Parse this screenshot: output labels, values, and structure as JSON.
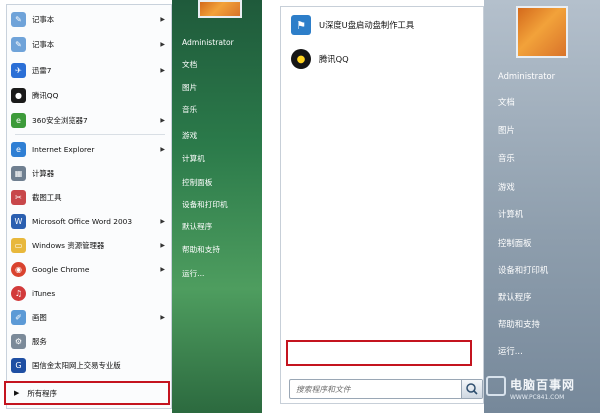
{
  "left": {
    "programs": [
      {
        "label": "记事本",
        "icon": "notepad-icon",
        "color": "#6fa3d9",
        "has_arrow": true
      },
      {
        "label": "记事本",
        "icon": "notepad-icon",
        "color": "#6fa3d9",
        "has_arrow": true
      },
      {
        "label": "迅雷7",
        "icon": "xunlei-icon",
        "color": "#2b6fd6",
        "has_arrow": true
      },
      {
        "label": "腾讯QQ",
        "icon": "qq-penguin-icon",
        "color": "#1a1a1a",
        "has_arrow": false
      },
      {
        "label": "360安全浏览器7",
        "icon": "360-browser-icon",
        "color": "#3d9b3a",
        "has_arrow": true
      },
      {
        "label": "Internet Explorer",
        "icon": "ie-icon",
        "color": "#2f7fd4",
        "has_arrow": true
      },
      {
        "label": "计算器",
        "icon": "calculator-icon",
        "color": "#6f7f90",
        "has_arrow": false
      },
      {
        "label": "截图工具",
        "icon": "snipping-tool-icon",
        "color": "#c8474a",
        "has_arrow": false
      },
      {
        "label": "Microsoft Office Word 2003",
        "icon": "word-icon",
        "color": "#2b5fb0",
        "has_arrow": true
      },
      {
        "label": "Windows 资源管理器",
        "icon": "explorer-folder-icon",
        "color": "#e8b83c",
        "has_arrow": true
      },
      {
        "label": "Google Chrome",
        "icon": "chrome-icon",
        "color": "#d9432f",
        "has_arrow": true
      },
      {
        "label": "iTunes",
        "icon": "itunes-icon",
        "color": "#d23b3b",
        "has_arrow": false
      },
      {
        "label": "画图",
        "icon": "paint-icon",
        "color": "#5c9ad6",
        "has_arrow": true
      },
      {
        "label": "服务",
        "icon": "services-gear-icon",
        "color": "#7b8a99",
        "has_arrow": false
      },
      {
        "label": "国信金太阳网上交易专业版",
        "icon": "guosen-icon",
        "color": "#1f4fa3",
        "has_arrow": false
      }
    ],
    "all_programs": "所有程序",
    "user": "Administrator",
    "side_links": [
      "文档",
      "图片",
      "音乐",
      "游戏",
      "计算机",
      "控制面板",
      "设备和打印机",
      "默认程序",
      "帮助和支持",
      "运行..."
    ]
  },
  "right": {
    "programs": [
      {
        "label": "U深度U盘启动盘制作工具",
        "icon": "udisk-tool-icon"
      },
      {
        "label": "腾讯QQ",
        "icon": "qq-penguin-icon"
      }
    ],
    "search_placeholder": "搜索程序和文件",
    "user": "Administrator",
    "side_links": [
      "文档",
      "图片",
      "音乐",
      "游戏",
      "计算机",
      "控制面板",
      "设备和打印机",
      "默认程序",
      "帮助和支持",
      "运行..."
    ]
  },
  "watermark": {
    "title": "电脑百事网",
    "url": "WWW.PC841.COM"
  }
}
